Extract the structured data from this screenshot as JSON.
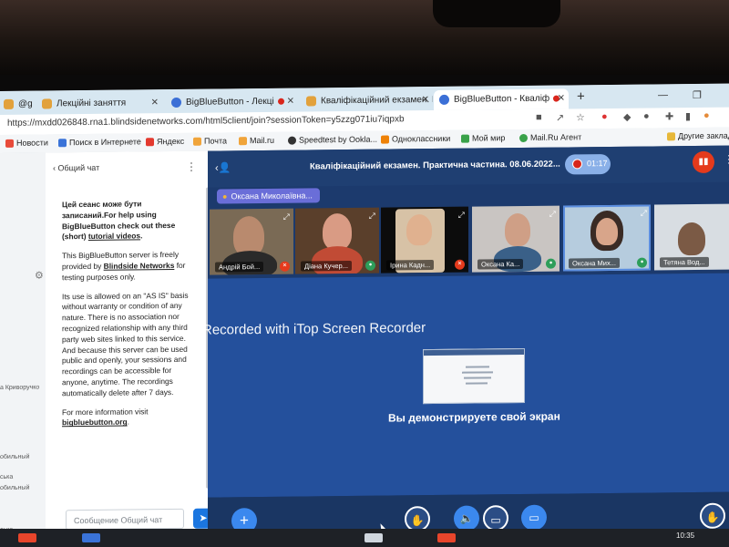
{
  "browser": {
    "tabs": [
      {
        "label": "@gr",
        "favicon": "gmail-icon"
      },
      {
        "label": "Лекційні заняття",
        "favicon": "moodle-icon"
      },
      {
        "label": "BigBlueButton - Лекці",
        "favicon": "bbb-icon",
        "recording": true
      },
      {
        "label": "Кваліфікаційний екзамен. П",
        "favicon": "moodle-icon"
      },
      {
        "label": "BigBlueButton - Кваліф",
        "favicon": "bbb-icon",
        "recording": true,
        "active": true
      }
    ],
    "url": "https://mxdd026848.rna1.blindsidenetworks.com/html5client/join?sessionToken=y5zzg071iu7iqpxb",
    "bookmarks": [
      "Новости",
      "Поиск в Интернете",
      "Яндекс",
      "Почта",
      "Mail.ru",
      "Speedtest by Ookla...",
      "Одноклассники",
      "Мой мир",
      "Mail.Ru Агент",
      "Другие заклад"
    ]
  },
  "userlist": {
    "fragments": [
      "а Криворучко",
      "обильный",
      "ська",
      "обильный",
      "ська"
    ]
  },
  "chat": {
    "header": "Общий чат",
    "welcome_bold": "Цей сеанс може бути записаний.",
    "welcome_text": "For help using BigBlueButton check out these (short)",
    "tutorial_link": "tutorial videos",
    "period": ".",
    "provided_text": "This BigBlueButton server is freely provided by",
    "blindside_link": "Blindside Networks",
    "provided_tail": "for testing purposes only.",
    "as_is_text": "Its use is allowed on an \"AS IS\" basis without warranty or condition of any nature. There is no association nor recognized relationship with any third party web sites linked to this service. And because this server can be used public and openly, your sessions and recordings can be accessible for anyone, anytime. The recordings automatically delete after 7 days.",
    "more_info": "For more information visit",
    "more_link": "bigbluebutton.org",
    "input_placeholder": "Сообщение Общий чат"
  },
  "meeting": {
    "title": "Кваліфікаційний екзамен. Практична частина. 08.06.2022...",
    "record_time": "01:17",
    "presenter": "Оксана Миколаївна..."
  },
  "participants": [
    "Андрій Бой...",
    "Діана Кучер...",
    "Ірина Кадн...",
    "Оксана Ка...",
    "Оксана Мих...",
    "Тетяна Вод..."
  ],
  "stage": {
    "watermark": "Recorded with iTop Screen Recorder",
    "share_label": "Вы демонстрируете свой экран"
  },
  "taskbar": {
    "clock": "10:35"
  },
  "colors": {
    "brand": "#1c3a6d",
    "accent": "#3b88ee",
    "record": "#d7261b"
  }
}
